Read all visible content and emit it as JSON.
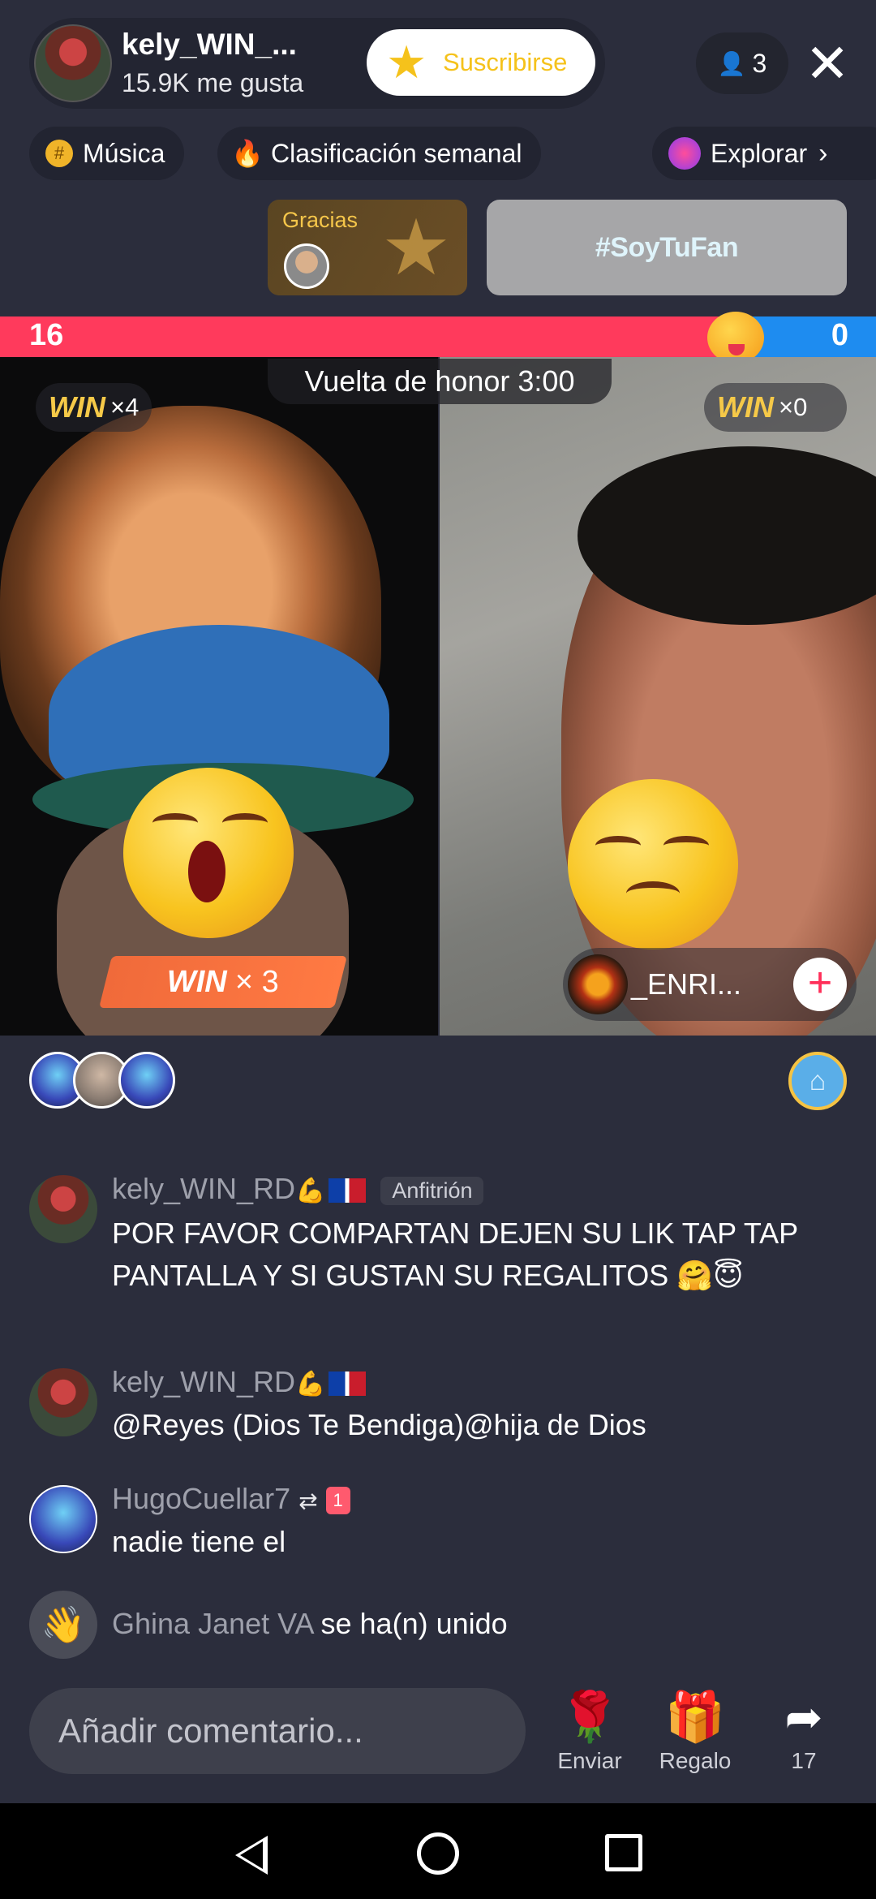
{
  "host": {
    "name": "kely_WIN_...",
    "likes": "15.9K me gusta",
    "subscribe_label": "Suscribirse",
    "viewer_count": "3"
  },
  "chips": [
    {
      "label": "Música",
      "icon": "music-badge-icon"
    },
    {
      "label": "Clasificación semanal",
      "icon": "flame-icon"
    },
    {
      "label": "Explorar",
      "icon": "planet-icon"
    }
  ],
  "gift_cards": {
    "thanks_label": "Gracias",
    "fan_label": "#SoyTuFan"
  },
  "score": {
    "left": "16",
    "right": "0"
  },
  "battle": {
    "timer": "Vuelta de honor 3:00",
    "win_word": "WIN",
    "left_wins": "×4",
    "right_wins": "×0",
    "banner_wins": "× 3",
    "guest_name": "_ENRI..."
  },
  "chat": [
    {
      "user": "kely_WIN_RD",
      "badge": "Anfitrión",
      "text": "POR FAVOR COMPARTAN DEJEN SU LIK TAP TAP PANTALLA Y SI GUSTAN SU REGALITOS 🤗😇"
    },
    {
      "user": "kely_WIN_RD",
      "text": "@Reyes (Dios Te Bendiga)@hija de Dios"
    },
    {
      "user": "HugoCuellar7",
      "text": "nadie tiene el"
    },
    {
      "user": "Ghina Janet VA",
      "text": "se ha(n) unido"
    }
  ],
  "bottom": {
    "comment_placeholder": "Añadir comentario...",
    "send_label": "Enviar",
    "gift_label": "Regalo",
    "share_count": "17"
  },
  "colors": {
    "background": "#2b2d3c",
    "score_red": "#ff3a5c",
    "score_blue": "#1e8cf0",
    "win_gold": "#f6c948",
    "follow_pink": "#ff2f59"
  }
}
